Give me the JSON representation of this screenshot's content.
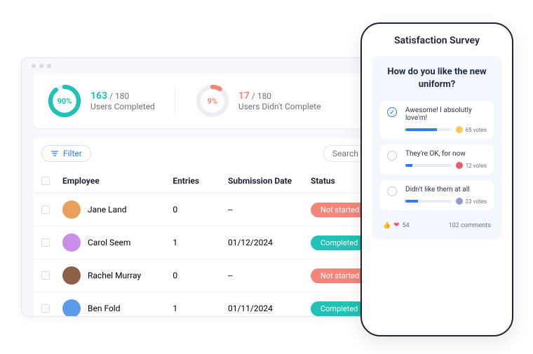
{
  "stats": {
    "completed": {
      "percent": "90%",
      "count": "163",
      "total": "/ 180",
      "label": "Users Completed",
      "color": "#1fc2b4"
    },
    "not_completed": {
      "percent": "9%",
      "count": "17",
      "total": "/ 180",
      "label": "Users Didn't Complete",
      "color": "#f4857a"
    }
  },
  "toolbar": {
    "filter": "Filter",
    "search_placeholder": "Search"
  },
  "table": {
    "headers": {
      "employee": "Employee",
      "entries": "Entries",
      "date": "Submission Date",
      "status": "Status"
    },
    "rows": [
      {
        "name": "Jane Land",
        "entries": "0",
        "date": "--",
        "status": "Not started",
        "status_color": "#f4857a",
        "avatar_bg": "#e8a05c"
      },
      {
        "name": "Carol Seem",
        "entries": "1",
        "date": "01/12/2024",
        "status": "Completed",
        "status_color": "#1fc2b4",
        "avatar_bg": "#c98fe8"
      },
      {
        "name": "Rachel Murray",
        "entries": "0",
        "date": "--",
        "status": "Not started",
        "status_color": "#f4857a",
        "avatar_bg": "#8f6048"
      },
      {
        "name": "Ben Fold",
        "entries": "1",
        "date": "01/11/2024",
        "status": "Completed",
        "status_color": "#1fc2b4",
        "avatar_bg": "#5c9be8"
      }
    ]
  },
  "phone": {
    "title": "Satisfaction Survey",
    "question": "How do you like the new uniform?",
    "options": [
      {
        "text": "Awesome! I absolutly love'm!",
        "votes": "65 votes",
        "checked": true,
        "bar_pct": 68,
        "icon_bg": "#f5c95c"
      },
      {
        "text": "They're OK, for now",
        "votes": "12 votes",
        "checked": false,
        "bar_pct": 15,
        "icon_bg": "#e85c6b"
      },
      {
        "text": "Didn't like them at all",
        "votes": "23 votes",
        "checked": false,
        "bar_pct": 28,
        "icon_bg": "#8f9bd8"
      }
    ],
    "likes": "54",
    "comments": "102 comments"
  }
}
